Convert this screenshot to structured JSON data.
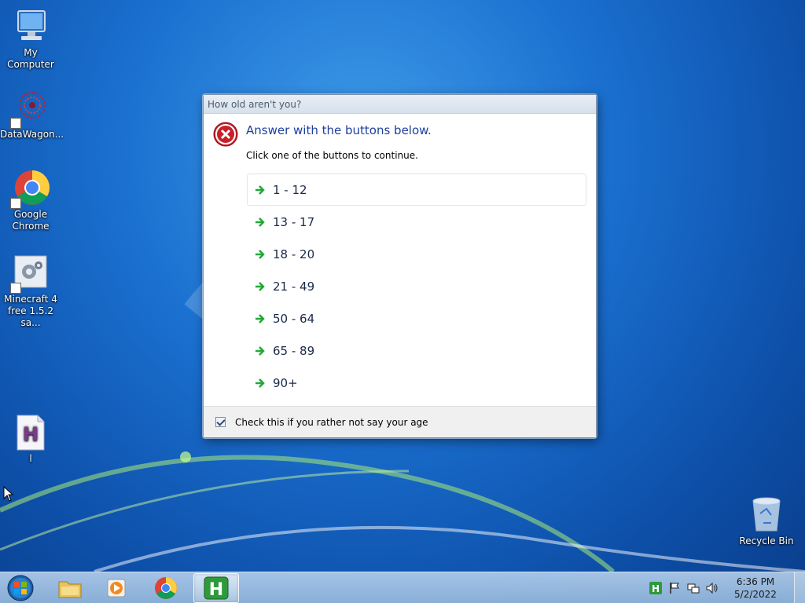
{
  "desktop": {
    "icons": [
      {
        "label": "My Computer",
        "icon": "computer-icon"
      },
      {
        "label": "DataWagon...",
        "icon": "datawagon-icon"
      },
      {
        "label": "Google Chrome",
        "icon": "chrome-icon"
      },
      {
        "label": "Minecraft 4 free 1.5.2 sa...",
        "icon": "minecraft-installer-icon"
      },
      {
        "label": "l",
        "icon": "h-document-icon"
      },
      {
        "label": "Recycle Bin",
        "icon": "recycle-bin-icon"
      }
    ]
  },
  "dialog": {
    "title": "How old aren't you?",
    "icon": "error-icon",
    "main_instruction": "Answer with the buttons below.",
    "content": "Click one of the buttons to continue.",
    "options": [
      "1 - 12",
      "13 - 17",
      "18 - 20",
      "21 - 49",
      "50 - 64",
      "65 - 89",
      "90+"
    ],
    "focused_option_index": 0,
    "verification": {
      "label": "Check this if you rather not say your age",
      "checked": true
    }
  },
  "taskbar": {
    "buttons": [
      "start-orb-icon",
      "file-explorer-icon",
      "media-player-icon",
      "chrome-icon",
      "h-app-icon"
    ],
    "active_button": "h-app-icon",
    "tray_icons": [
      "h-app-tray-icon",
      "action-center-flag-icon",
      "network-icon",
      "volume-icon"
    ],
    "clock": {
      "time": "6:36 PM",
      "date": "5/2/2022"
    }
  },
  "colors": {
    "instruction_blue": "#1e3f9e",
    "arrow_green": "#22a83a",
    "error_red": "#c8202a"
  }
}
